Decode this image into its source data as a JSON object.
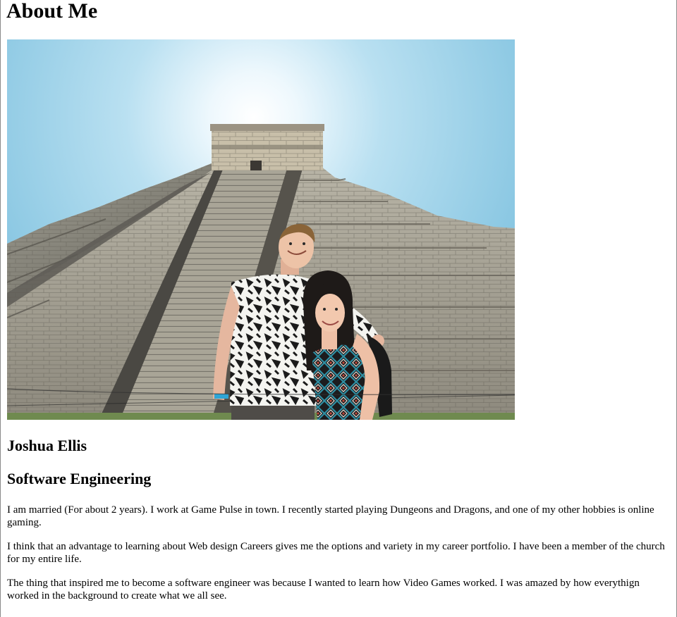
{
  "page": {
    "heading": "About Me",
    "photo_alt": "Couple standing in front of a stepped stone pyramid under a blue sky"
  },
  "profile": {
    "name": "Joshua Ellis",
    "field": "Software Engineering"
  },
  "paragraphs": [
    "I am married (For about 2 years). I work at Game Pulse in town. I recently started playing Dungeons and Dragons, and one of my other hobbies is online gaming.",
    "I think that an advantage to learning about Web design Careers gives me the options and variety in my career portfolio. I have been a member of the church for my entire life.",
    "The thing that inspired me to become a software engineer was because I wanted to learn how Video Games worked. I was amazed by how everythign worked in the background to create what we all see."
  ]
}
